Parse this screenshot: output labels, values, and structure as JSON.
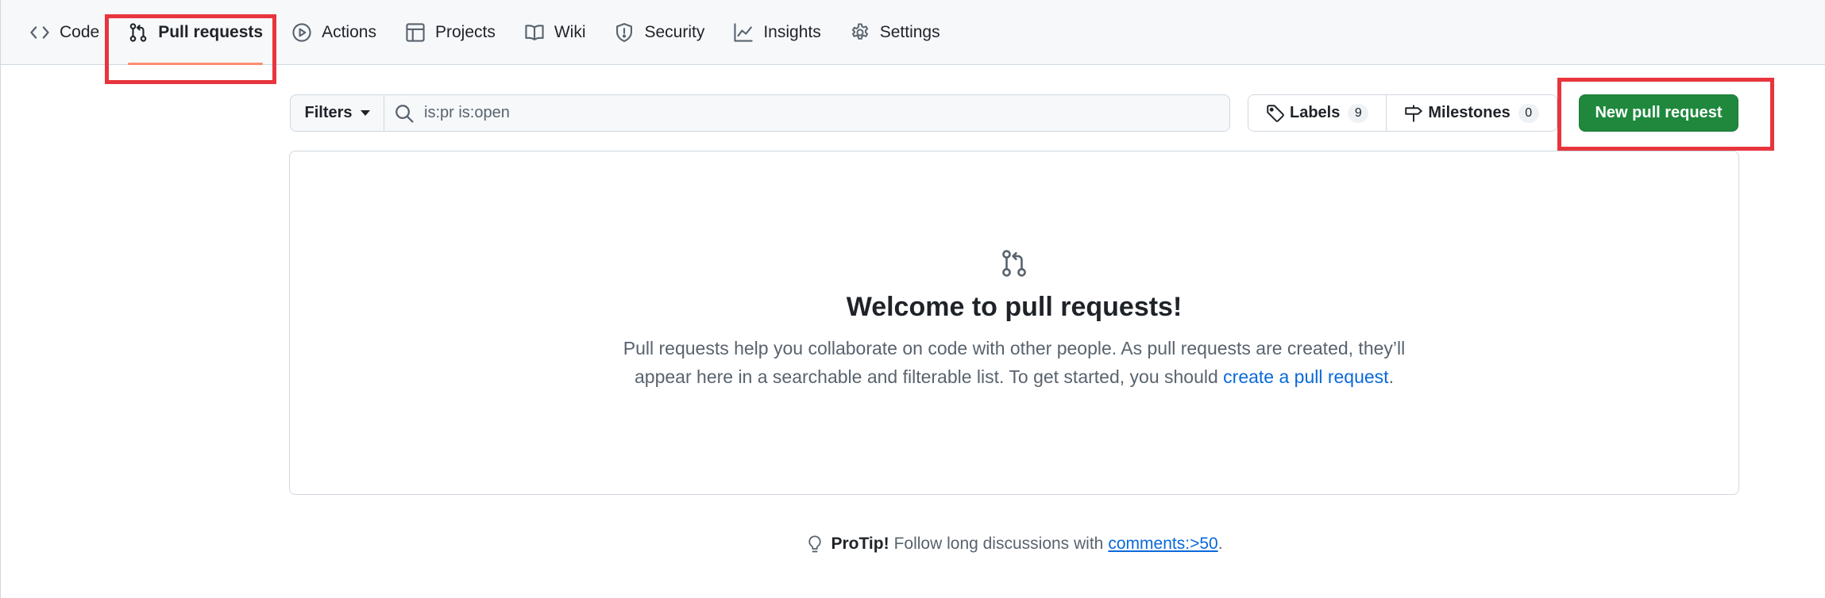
{
  "nav": {
    "tabs": [
      {
        "label": "Code",
        "icon": "code-icon"
      },
      {
        "label": "Pull requests",
        "icon": "git-pull-request-icon",
        "active": true
      },
      {
        "label": "Actions",
        "icon": "play-icon"
      },
      {
        "label": "Projects",
        "icon": "table-icon"
      },
      {
        "label": "Wiki",
        "icon": "book-icon"
      },
      {
        "label": "Security",
        "icon": "shield-icon"
      },
      {
        "label": "Insights",
        "icon": "graph-icon"
      },
      {
        "label": "Settings",
        "icon": "gear-icon"
      }
    ]
  },
  "subnav": {
    "filters_label": "Filters",
    "search_value": "is:pr is:open",
    "labels_label": "Labels",
    "labels_count": "9",
    "milestones_label": "Milestones",
    "milestones_count": "0",
    "new_pr_label": "New pull request"
  },
  "blankslate": {
    "title": "Welcome to pull requests!",
    "line1": "Pull requests help you collaborate on code with other people. As pull requests are created, they’ll",
    "line2_prefix": "appear here in a searchable and filterable list. To get started, you should ",
    "link_text": "create a pull request",
    "line2_suffix": "."
  },
  "protip": {
    "label": "ProTip!",
    "text": "Follow long discussions with",
    "link": "comments:>50",
    "suffix": "."
  },
  "colors": {
    "primary_button": "#1f883d",
    "link": "#0969da",
    "active_underline": "#fd8c73",
    "highlight_box": "#e8353d"
  }
}
